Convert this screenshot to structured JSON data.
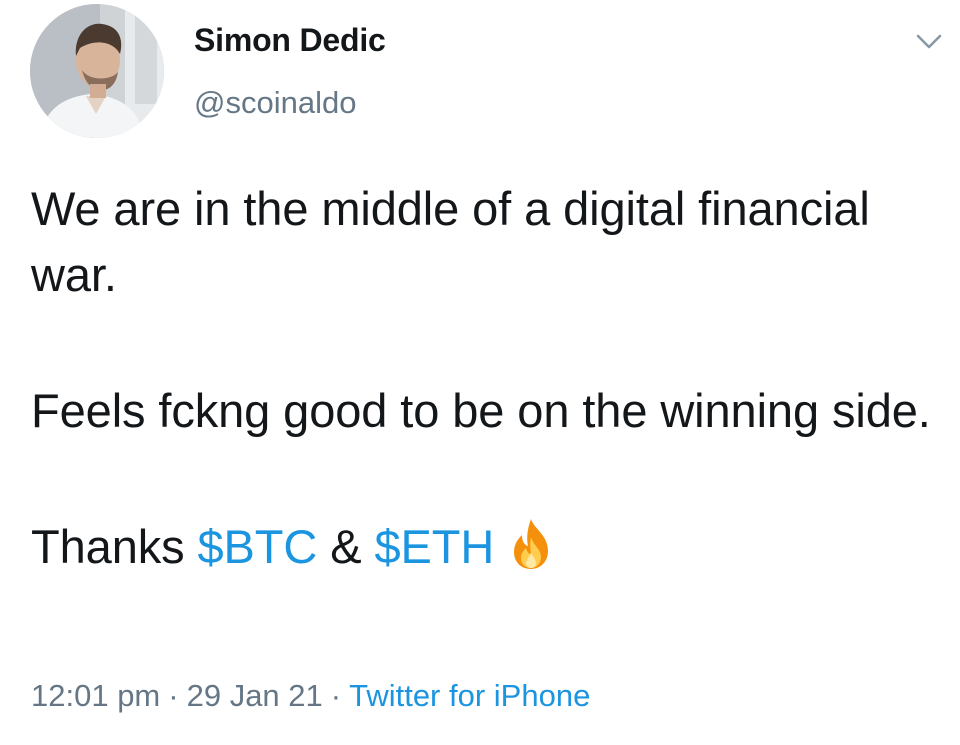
{
  "author": {
    "name": "Simon Dedic",
    "handle": "@scoinaldo"
  },
  "tweet": {
    "paragraphs": [
      "We are in the middle of a digital financial war.",
      "Feels fckng good to be on the winning side."
    ],
    "thanks_prefix": "Thanks",
    "cashtag_1": "$BTC",
    "ampersand": "&",
    "cashtag_2": "$ETH",
    "emoji": "fire-emoji"
  },
  "meta": {
    "time": "12:01 pm",
    "separator": "·",
    "date": "29 Jan 21",
    "source": "Twitter for iPhone"
  },
  "icons": {
    "menu": "chevron-down-icon"
  },
  "colors": {
    "link": "#1b95e0",
    "secondary_text": "#657786",
    "primary_text": "#14171a"
  }
}
